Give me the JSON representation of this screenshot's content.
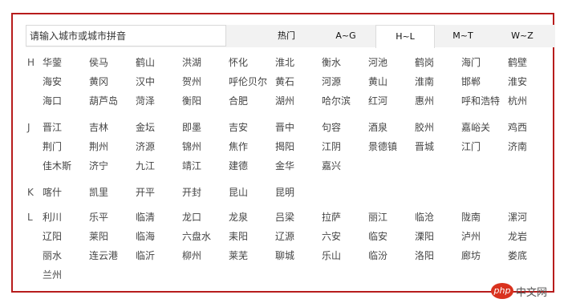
{
  "search": {
    "placeholder": "请输入城市或城市拼音"
  },
  "tabs": [
    {
      "label": "热门",
      "active": false
    },
    {
      "label": "A~G",
      "active": false
    },
    {
      "label": "H~L",
      "active": true
    },
    {
      "label": "M~T",
      "active": false
    },
    {
      "label": "W~Z",
      "active": false
    }
  ],
  "groups": [
    {
      "letter": "H",
      "cities": [
        "华蓥",
        "侯马",
        "鹤山",
        "洪湖",
        "怀化",
        "淮北",
        "衡水",
        "河池",
        "鹤岗",
        "海门",
        "鹤壁",
        "海安",
        "黄冈",
        "汉中",
        "贺州",
        "呼伦贝尔",
        "黄石",
        "河源",
        "黄山",
        "淮南",
        "邯郸",
        "淮安",
        "海口",
        "葫芦岛",
        "菏泽",
        "衡阳",
        "合肥",
        "湖州",
        "哈尔滨",
        "红河",
        "惠州",
        "呼和浩特",
        "杭州"
      ]
    },
    {
      "letter": "J",
      "cities": [
        "晋江",
        "吉林",
        "金坛",
        "即墨",
        "吉安",
        "晋中",
        "句容",
        "酒泉",
        "胶州",
        "嘉峪关",
        "鸡西",
        "荆门",
        "荆州",
        "济源",
        "锦州",
        "焦作",
        "揭阳",
        "江阴",
        "景德镇",
        "晋城",
        "江门",
        "济南",
        "佳木斯",
        "济宁",
        "九江",
        "靖江",
        "建德",
        "金华",
        "嘉兴"
      ]
    },
    {
      "letter": "K",
      "cities": [
        "喀什",
        "凯里",
        "开平",
        "开封",
        "昆山",
        "昆明"
      ]
    },
    {
      "letter": "L",
      "cities": [
        "利川",
        "乐平",
        "临清",
        "龙口",
        "龙泉",
        "吕梁",
        "拉萨",
        "丽江",
        "临沧",
        "陇南",
        "漯河",
        "辽阳",
        "莱阳",
        "临海",
        "六盘水",
        "耒阳",
        "辽源",
        "六安",
        "临安",
        "溧阳",
        "泸州",
        "龙岩",
        "丽水",
        "连云港",
        "临沂",
        "柳州",
        "莱芜",
        "聊城",
        "乐山",
        "临汾",
        "洛阳",
        "廊坊",
        "娄底",
        "兰州"
      ]
    }
  ],
  "watermark": {
    "badge": "php",
    "text": "中文网"
  }
}
